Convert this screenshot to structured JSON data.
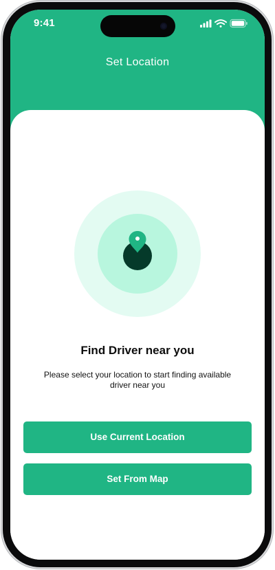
{
  "status_bar": {
    "time": "9:41",
    "icons": [
      "signal-icon",
      "wifi-icon",
      "battery-icon"
    ]
  },
  "header": {
    "title": "Set Location",
    "color": "#20b584"
  },
  "illustration": {
    "icon": "location-pin-icon",
    "ring_colors": [
      "#e3fbf2",
      "#b8f6de",
      "#053a2a"
    ]
  },
  "content": {
    "headline": "Find Driver near you",
    "subtext": "Please select your location to start finding available driver near you"
  },
  "buttons": {
    "current_location": "Use Current Location",
    "from_map": "Set From Map"
  },
  "colors": {
    "accent": "#20b584",
    "text": "#0d0d0d"
  }
}
